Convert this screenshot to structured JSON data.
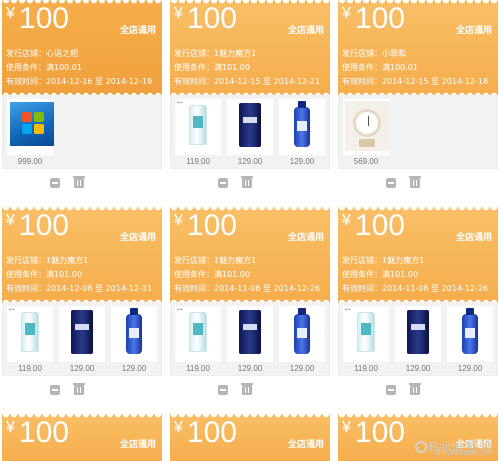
{
  "currency_symbol": "¥",
  "colors": {
    "coupon_orange": "#f8b85a",
    "coupon_dark": "#f0a03d",
    "icon_gray": "#b5b5b5",
    "price_gray": "#777777"
  },
  "icons": {
    "edit": "edit-icon",
    "delete": "trash-icon"
  },
  "coupons": [
    {
      "amount": "100",
      "scope": "全店通用",
      "store": "发行店铺：心语之相",
      "condition": "使用条件：满100.01",
      "period": "有效时间：2014-12-16 至 2014-12-19",
      "products": [
        {
          "kind": "windows",
          "price": "999.00"
        }
      ]
    },
    {
      "amount": "100",
      "scope": "全店通用",
      "store": "发行店铺：1魅力魔方1",
      "condition": "使用条件：满101.00",
      "period": "有效时间：2014-12-15 至 2014-12-21",
      "products": [
        {
          "kind": "tube",
          "price": "119.00"
        },
        {
          "kind": "dark-tube",
          "price": "129.00"
        },
        {
          "kind": "bottle",
          "price": "129.00"
        }
      ]
    },
    {
      "amount": "100",
      "scope": "全店通用",
      "store": "发行店铺：小罪和",
      "condition": "使用条件：满100.01",
      "period": "有效时间：2014-12-15 至 2014-12-18",
      "products": [
        {
          "kind": "clock",
          "price": "569.00"
        }
      ]
    },
    {
      "amount": "100",
      "scope": "全店通用",
      "store": "发行店铺：1魅力魔方1",
      "condition": "使用条件：满101.00",
      "period": "有效时间：2014-12-08 至 2014-12-31",
      "products": [
        {
          "kind": "tube",
          "price": "119.00"
        },
        {
          "kind": "dark-tube",
          "price": "129.00"
        },
        {
          "kind": "bottle",
          "price": "129.00"
        }
      ]
    },
    {
      "amount": "100",
      "scope": "全店通用",
      "store": "发行店铺：1魅力魔方1",
      "condition": "使用条件：满101.00",
      "period": "有效时间：2014-11-08 至 2014-12-26",
      "products": [
        {
          "kind": "tube",
          "price": "119.00"
        },
        {
          "kind": "dark-tube",
          "price": "129.00"
        },
        {
          "kind": "bottle",
          "price": "129.00"
        }
      ]
    },
    {
      "amount": "100",
      "scope": "全店通用",
      "store": "发行店铺：1魅力魔方1",
      "condition": "使用条件：满101.00",
      "period": "有效时间：2014-11-08 至 2014-12-26",
      "products": [
        {
          "kind": "tube",
          "price": "119.00"
        },
        {
          "kind": "dark-tube",
          "price": "129.00"
        },
        {
          "kind": "bottle",
          "price": "129.00"
        }
      ]
    },
    {
      "amount": "100",
      "scope": "全店通用"
    },
    {
      "amount": "100",
      "scope": "全店通用"
    },
    {
      "amount": "100",
      "scope": "全店通用"
    }
  ],
  "watermark": {
    "text": "Baidu 经验",
    "sub": "jingyan.baidu.com"
  }
}
